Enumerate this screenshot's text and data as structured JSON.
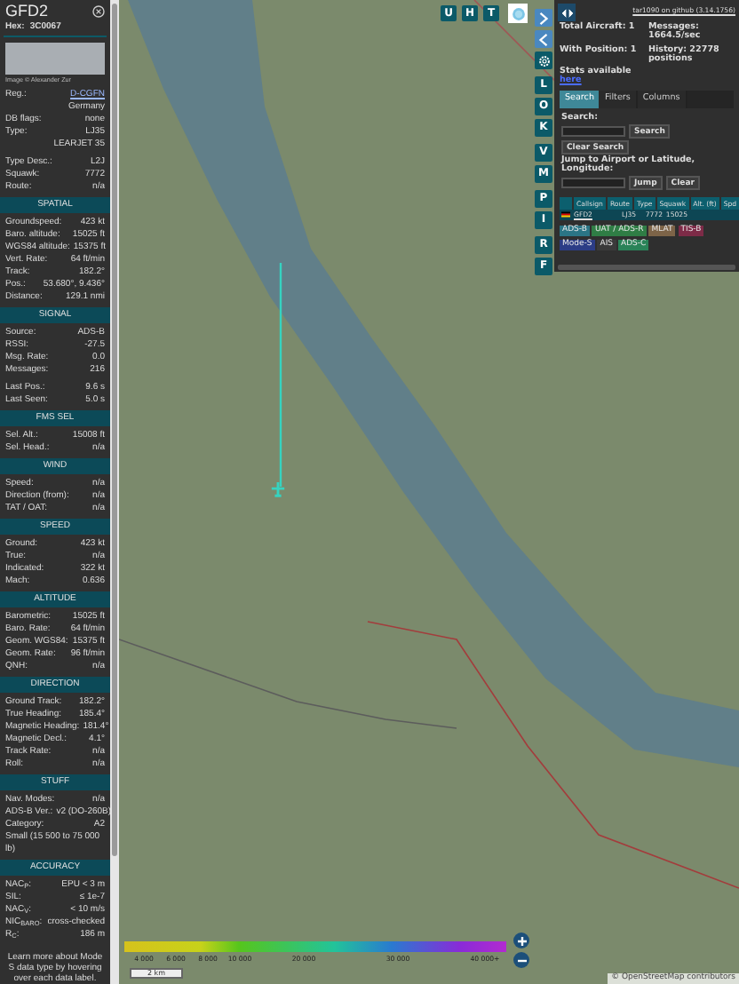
{
  "aircraft_panel": {
    "callsign": "GFD2",
    "hex_label": "Hex:",
    "hex": "3C0067",
    "photo_credit": "Image © Alexander Zur",
    "info_groups": [
      [
        {
          "kind": "link",
          "label": "Reg.:",
          "value": "D-CGFN"
        },
        {
          "kind": "note",
          "value": "Germany"
        },
        {
          "kind": "row",
          "label": "DB flags:",
          "value": "none"
        },
        {
          "kind": "row",
          "label": "Type:",
          "value": "LJ35"
        },
        {
          "kind": "note",
          "value": "LEARJET 35"
        }
      ],
      [
        {
          "kind": "row",
          "label": "Type Desc.:",
          "value": "L2J"
        },
        {
          "kind": "row",
          "label": "Squawk:",
          "value": "7772"
        },
        {
          "kind": "row",
          "label": "Route:",
          "value": "n/a"
        }
      ]
    ],
    "sections": [
      {
        "title": "SPATIAL",
        "groups": [
          [
            {
              "kind": "row",
              "label": "Groundspeed:",
              "value": "423 kt"
            },
            {
              "kind": "row",
              "label": "Baro. altitude:",
              "value": "15025 ft"
            },
            {
              "kind": "row",
              "label": "WGS84 altitude:",
              "value": "15375 ft"
            },
            {
              "kind": "row",
              "label": "Vert. Rate:",
              "value": "64 ft/min"
            },
            {
              "kind": "row",
              "label": "Track:",
              "value": "182.2°"
            },
            {
              "kind": "row",
              "label": "Pos.:",
              "value": "53.680°, 9.436°"
            },
            {
              "kind": "row",
              "label": "Distance:",
              "value": "129.1 nmi"
            }
          ]
        ]
      },
      {
        "title": "SIGNAL",
        "groups": [
          [
            {
              "kind": "row",
              "label": "Source:",
              "value": "ADS-B"
            },
            {
              "kind": "row",
              "label": "RSSI:",
              "value": "-27.5"
            },
            {
              "kind": "row",
              "label": "Msg. Rate:",
              "value": "0.0"
            },
            {
              "kind": "row",
              "label": "Messages:",
              "value": "216"
            }
          ],
          [
            {
              "kind": "row",
              "label": "Last Pos.:",
              "value": "9.6 s"
            },
            {
              "kind": "row",
              "label": "Last Seen:",
              "value": "5.0 s"
            }
          ]
        ]
      },
      {
        "title": "FMS SEL",
        "groups": [
          [
            {
              "kind": "row",
              "label": "Sel. Alt.:",
              "value": "15008 ft"
            },
            {
              "kind": "row",
              "label": "Sel. Head.:",
              "value": "n/a"
            }
          ]
        ]
      },
      {
        "title": "WIND",
        "groups": [
          [
            {
              "kind": "row",
              "label": "Speed:",
              "value": "n/a"
            },
            {
              "kind": "row",
              "label": "Direction (from):",
              "value": "n/a"
            },
            {
              "kind": "row",
              "label": "TAT / OAT:",
              "value": "n/a"
            }
          ]
        ]
      },
      {
        "title": "SPEED",
        "groups": [
          [
            {
              "kind": "row",
              "label": "Ground:",
              "value": "423 kt"
            },
            {
              "kind": "row",
              "label": "True:",
              "value": "n/a"
            },
            {
              "kind": "row",
              "label": "Indicated:",
              "value": "322 kt"
            },
            {
              "kind": "row",
              "label": "Mach:",
              "value": "0.636"
            }
          ]
        ]
      },
      {
        "title": "ALTITUDE",
        "groups": [
          [
            {
              "kind": "row",
              "label": "Barometric:",
              "value": "15025 ft"
            },
            {
              "kind": "row",
              "label": "Baro. Rate:",
              "value": "64 ft/min"
            },
            {
              "kind": "row",
              "label": "Geom. WGS84:",
              "value": "15375 ft"
            },
            {
              "kind": "row",
              "label": "Geom. Rate:",
              "value": "96 ft/min"
            },
            {
              "kind": "row",
              "label": "QNH:",
              "value": "n/a"
            }
          ]
        ]
      },
      {
        "title": "DIRECTION",
        "groups": [
          [
            {
              "kind": "row",
              "label": "Ground Track:",
              "value": "182.2°"
            },
            {
              "kind": "row",
              "label": "True Heading:",
              "value": "185.4°"
            },
            {
              "kind": "row",
              "label": "Magnetic Heading:",
              "value": "181.4°"
            },
            {
              "kind": "row",
              "label": "Magnetic Decl.:",
              "value": "4.1°"
            },
            {
              "kind": "row",
              "label": "Track Rate:",
              "value": "n/a"
            },
            {
              "kind": "row",
              "label": "Roll:",
              "value": "n/a"
            }
          ]
        ]
      },
      {
        "title": "STUFF",
        "groups": [
          [
            {
              "kind": "row",
              "label": "Nav. Modes:",
              "value": "n/a"
            },
            {
              "kind": "row",
              "label": "ADS-B Ver.:",
              "value": "v2 (DO-260B)"
            },
            {
              "kind": "row",
              "label": "Category:",
              "value": "A2"
            },
            {
              "kind": "text",
              "value": "Small (15 500 to 75 000 lb)"
            }
          ]
        ]
      },
      {
        "title": "ACCURACY",
        "groups": [
          [
            {
              "kind": "row",
              "label": "NAC$_{P}$:",
              "value": "EPU < 3 m"
            },
            {
              "kind": "row",
              "label": "SIL:",
              "value": "≤ 1e-7"
            },
            {
              "kind": "row",
              "label": "NAC$_{V}$:",
              "value": "< 10 m/s"
            },
            {
              "kind": "row",
              "label": "NIC$_{BARO}$:",
              "value": "cross-checked"
            },
            {
              "kind": "row",
              "label": "R$_{C}$:",
              "value": "186 m"
            }
          ]
        ]
      }
    ],
    "footer": "Learn more about Mode S data type by hovering over each data label."
  },
  "map": {
    "top_buttons": [
      "U",
      "H",
      "T"
    ],
    "side_buttons": [
      {
        "kind": "next"
      },
      {
        "kind": "prev"
      },
      {
        "kind": "settings"
      },
      {
        "kind": "letter",
        "label": "L"
      },
      {
        "kind": "letter",
        "label": "O"
      },
      {
        "kind": "letter",
        "label": "K"
      },
      {
        "kind": "letter",
        "label": "V"
      },
      {
        "kind": "letter",
        "label": "M"
      },
      {
        "kind": "letter",
        "label": "P"
      },
      {
        "kind": "letter",
        "label": "I"
      },
      {
        "kind": "letter",
        "label": "R"
      },
      {
        "kind": "letter",
        "label": "F"
      }
    ],
    "altitude_legend": [
      "4 000",
      "6 000",
      "8 000",
      "10 000",
      "20 000",
      "30 000",
      "40 000+"
    ],
    "scale": "2 km",
    "attribution": "© OpenStreetMap contributors"
  },
  "side_panel": {
    "version_link": "tar1090 on github (3.14.1756)",
    "stats": [
      {
        "label": "Total Aircraft: 1"
      },
      {
        "label": "Messages: 1664.5/sec"
      },
      {
        "label": "With Position: 1"
      },
      {
        "label": "History: 22778 positions"
      }
    ],
    "stats_note": "Stats available",
    "stats_link": "here",
    "tabs": [
      {
        "label": "Search",
        "selected": true
      },
      {
        "label": "Filters",
        "selected": false
      },
      {
        "label": "Columns",
        "selected": false
      }
    ],
    "search_label": "Search:",
    "search_button": "Search",
    "clear_search_button": "Clear Search",
    "jump_label": "Jump to Airport or Latitude, Longitude:",
    "jump_button": "Jump",
    "clear_button": "Clear",
    "table": {
      "columns": [
        "Callsign",
        "Route",
        "Type",
        "Squawk",
        "Alt. (ft)",
        "Spd"
      ],
      "rows": [
        {
          "selected": true,
          "callsign": "GFD2",
          "type": "LJ35",
          "squawk": "7772",
          "altitude": "15025"
        }
      ]
    },
    "legend": [
      {
        "label": "ADS-B",
        "color": "#2b7585"
      },
      {
        "label": "UAT / ADS-R",
        "color": "#2f7d45"
      },
      {
        "label": "MLAT",
        "color": "#7d6448"
      },
      {
        "label": "TIS-B",
        "color": "#7d2b47"
      },
      {
        "label": "Mode-S",
        "color": "#2c3d86"
      },
      {
        "label": "AIS",
        "color": "#3a3a3a"
      },
      {
        "label": "ADS-C",
        "color": "#2a8358"
      }
    ]
  }
}
